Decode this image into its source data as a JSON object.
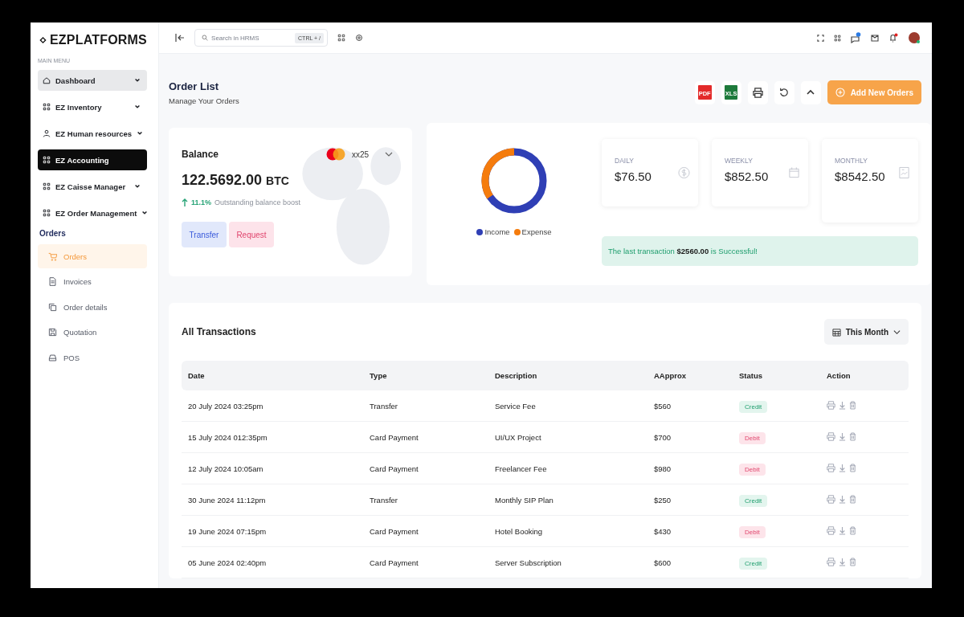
{
  "brand": "EZPLATFORMS",
  "sidebar": {
    "section": "MAIN MENU",
    "items": [
      {
        "label": "Dashboard",
        "selected": false,
        "hovered": true,
        "expandable": true
      },
      {
        "label": "EZ Inventory",
        "selected": false,
        "hovered": false,
        "expandable": true
      },
      {
        "label": "EZ Human resources",
        "selected": false,
        "hovered": false,
        "expandable": true
      },
      {
        "label": "EZ Accounting",
        "selected": true,
        "hovered": false,
        "expandable": false
      },
      {
        "label": "EZ Caisse Manager",
        "selected": false,
        "hovered": false,
        "expandable": true
      },
      {
        "label": "EZ Order Management",
        "selected": false,
        "hovered": false,
        "expandable": true
      }
    ],
    "group": "Orders",
    "subitems": [
      {
        "label": "Orders",
        "selected": true
      },
      {
        "label": "Invoices",
        "selected": false
      },
      {
        "label": "Order details",
        "selected": false
      },
      {
        "label": "Quotation",
        "selected": false
      },
      {
        "label": "POS",
        "selected": false
      }
    ]
  },
  "topbar": {
    "search": {
      "placeholder": "Search in HRMS",
      "shortcut": "CTRL + /"
    }
  },
  "page": {
    "title": "Order List",
    "subtitle": "Manage Your Orders",
    "pdf_label": "PDF",
    "xls_label": "XLS",
    "add_button": "Add New Orders"
  },
  "balance": {
    "title": "Balance",
    "card": "xx25",
    "amount": "122.5692.00",
    "currency": "BTC",
    "change": "11.1%",
    "change_text": "Outstanding balance boost",
    "buttons": [
      "Transfer",
      "Request"
    ]
  },
  "summary": {
    "legend": [
      {
        "label": "Income",
        "color": "#2f3fb5"
      },
      {
        "label": "Expense",
        "color": "#f57c0d"
      }
    ],
    "stats": [
      {
        "label": "DAILY",
        "value": "$76.50"
      },
      {
        "label": "WEEKLY",
        "value": "$852.50"
      },
      {
        "label": "MONTHLY",
        "value": "$8542.50"
      }
    ],
    "alert": {
      "before": "The last transaction",
      "amount": "$2560.00",
      "after": "is Successful!"
    }
  },
  "transactions": {
    "title": "All Transactions",
    "period": "This Month",
    "columns": [
      "Date",
      "Type",
      "Description",
      "AApprox",
      "Status",
      "Action"
    ],
    "rows": [
      {
        "date": "20 July 2024 03:25pm",
        "type": "Transfer",
        "description": "Service Fee",
        "amount": "$560",
        "status": {
          "label": "Credit",
          "kind": "credit"
        }
      },
      {
        "date": "15 July 2024 012:35pm",
        "type": "Card Payment",
        "description": "UI/UX Project",
        "amount": "$700",
        "status": {
          "label": "Debit",
          "kind": "debit"
        }
      },
      {
        "date": "12 July 2024 10:05am",
        "type": "Card Payment",
        "description": "Freelancer Fee",
        "amount": "$980",
        "status": {
          "label": "Debit",
          "kind": "debit"
        }
      },
      {
        "date": "30 June 2024 11:12pm",
        "type": "Transfer",
        "description": "Monthly SIP Plan",
        "amount": "$250",
        "status": {
          "label": "Credit",
          "kind": "credit"
        }
      },
      {
        "date": "19 June 2024 07:15pm",
        "type": "Card Payment",
        "description": "Hotel Booking",
        "amount": "$430",
        "status": {
          "label": "Debit",
          "kind": "debit"
        }
      },
      {
        "date": "05 June 2024 02:40pm",
        "type": "Card Payment",
        "description": "Server Subscription",
        "amount": "$600",
        "status": {
          "label": "Credit",
          "kind": "credit"
        }
      }
    ]
  }
}
